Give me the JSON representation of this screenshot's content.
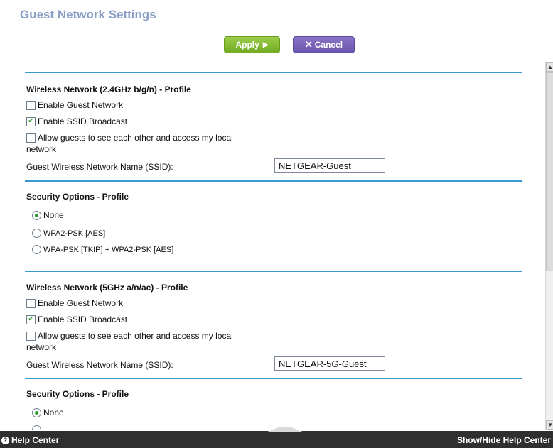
{
  "title": "Guest Network Settings",
  "buttons": {
    "apply": "Apply",
    "apply_glyph": "▶",
    "cancel": "Cancel",
    "cancel_glyph": "✕"
  },
  "band24": {
    "heading": "Wireless Network (2.4GHz b/g/n) - Profile",
    "enable_guest": {
      "label": "Enable Guest Network",
      "checked": false
    },
    "enable_ssid": {
      "label": "Enable SSID Broadcast",
      "checked": true
    },
    "allow_guests": {
      "label_line1": "Allow guests to see each other and access my local",
      "label_line2": "network",
      "checked": false
    },
    "ssid_label": "Guest Wireless Network Name (SSID):",
    "ssid_value": "NETGEAR-Guest",
    "security_heading": "Security Options - Profile",
    "security_options": [
      "None",
      "WPA2-PSK [AES]",
      "WPA-PSK [TKIP] + WPA2-PSK [AES]"
    ],
    "security_selected": "None"
  },
  "band5": {
    "heading": "Wireless Network (5GHz a/n/ac) - Profile",
    "enable_guest": {
      "label": "Enable Guest Network",
      "checked": false
    },
    "enable_ssid": {
      "label": "Enable SSID Broadcast",
      "checked": true
    },
    "allow_guests": {
      "label_line1": "Allow guests to see each other and access my local",
      "label_line2": "network",
      "checked": false
    },
    "ssid_label": "Guest Wireless Network Name (SSID):",
    "ssid_value": "NETGEAR-5G-Guest",
    "security_heading": "Security Options - Profile",
    "security_options": [
      "None"
    ],
    "security_selected": "None"
  },
  "helpbar": {
    "left_label": "Help Center",
    "right_label": "Show/Hide Help Center"
  },
  "colors": {
    "accent_rule": "#3a9ad0",
    "title": "#8a9fc4",
    "apply": "#7fb52e",
    "cancel": "#7560b8",
    "helpbar": "#2f2f2f"
  }
}
